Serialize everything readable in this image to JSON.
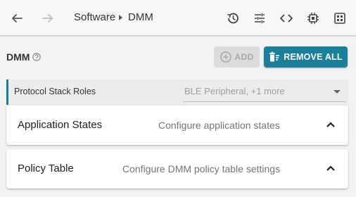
{
  "breadcrumb": {
    "items": [
      "Software",
      "DMM"
    ]
  },
  "toolbar": {
    "back_icon": "arrow-left-icon",
    "forward_icon": "arrow-right-icon",
    "tools": [
      "history-icon",
      "tune-icon",
      "code-icon",
      "chip-icon",
      "memory-icon"
    ]
  },
  "header": {
    "title": "DMM",
    "add_label": "ADD",
    "remove_all_label": "REMOVE ALL"
  },
  "protocol_roles": {
    "label": "Protocol Stack Roles",
    "value": "BLE Peripheral, +1 more"
  },
  "cards": [
    {
      "title": "Application States",
      "description": "Configure application states"
    },
    {
      "title": "Policy Table",
      "description": "Configure DMM policy table settings"
    }
  ],
  "colors": {
    "accent": "#1a7f99",
    "disabled": "#dcdcdc"
  }
}
